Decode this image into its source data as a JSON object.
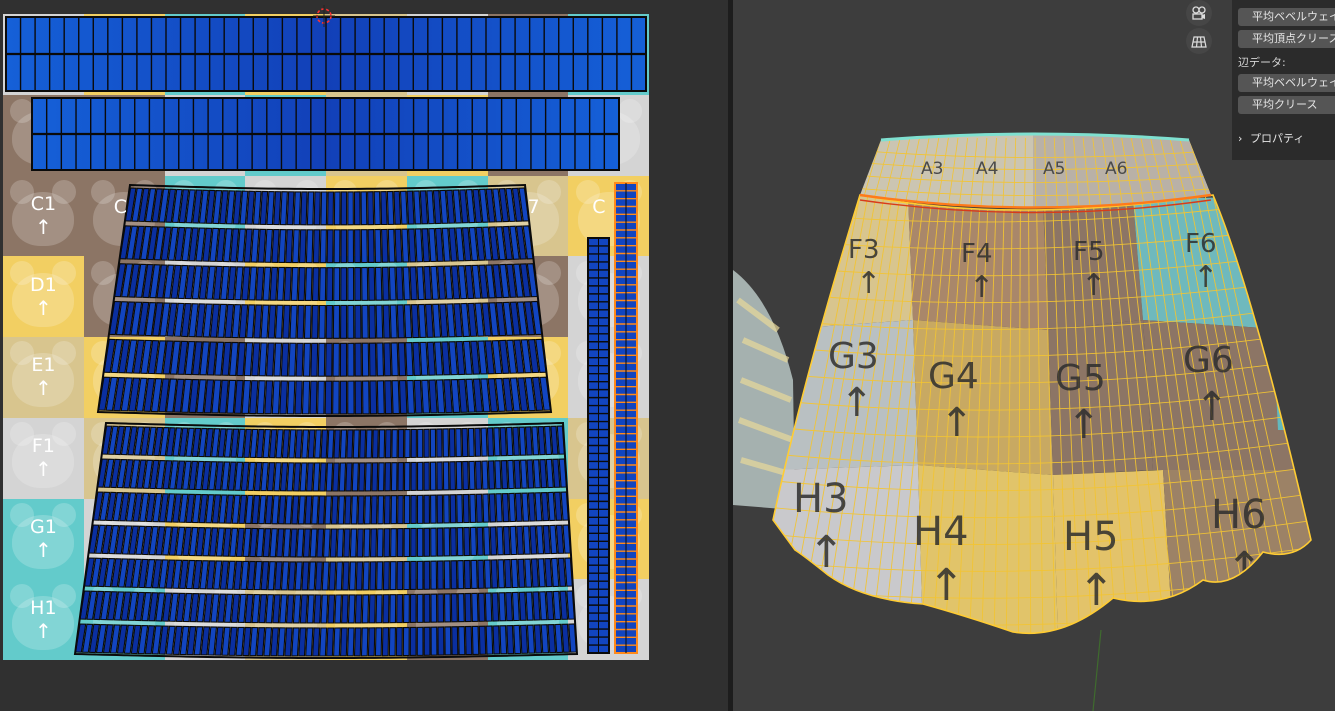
{
  "uv_editor": {
    "texture": {
      "colors": {
        "yellow": "#f2cf62",
        "brown": "#8c7565",
        "teal": "#63cbcb",
        "light": "#d4d4d4",
        "tan": "#d8c58e"
      },
      "visible_labels": [
        {
          "label": "C1",
          "arrow": "↑"
        },
        {
          "label": "D1",
          "arrow": "↑"
        },
        {
          "label": "E1",
          "arrow": "↑"
        },
        {
          "label": "F1",
          "arrow": "↑"
        },
        {
          "label": "G1",
          "arrow": "↑"
        },
        {
          "label": "H1",
          "arrow": "↑"
        }
      ],
      "partial_labels": {
        "c2": "C",
        "c7": "7",
        "c8": "C"
      }
    },
    "mesh_colors": {
      "face": "#1245c0",
      "edge": "#0a0a0a",
      "selected_edge": "#ff8a1a",
      "face_dark": "#0a2fa0"
    }
  },
  "viewport": {
    "background": "#3d3d3d",
    "gizmo_icons": [
      "camera-icon",
      "grid-icon"
    ],
    "skirt_labels": {
      "waistband": [
        "A3",
        "A4",
        "A5",
        "A6"
      ],
      "row_f": [
        "F3",
        "F4",
        "F5",
        "F6"
      ],
      "row_g": [
        "G3",
        "G4",
        "G5",
        "G6"
      ],
      "row_h": [
        "H3",
        "H4",
        "H5",
        "H6"
      ],
      "arrow": "↑"
    }
  },
  "n_panel": {
    "vertex_buttons": [
      "平均ベベルウェイト",
      "平均頂点クリース"
    ],
    "edge_data_label": "辺データ:",
    "edge_buttons": [
      "平均ベベルウェイト",
      "平均クリース"
    ],
    "properties_section": "プロパティ",
    "section_chevron": "›"
  }
}
